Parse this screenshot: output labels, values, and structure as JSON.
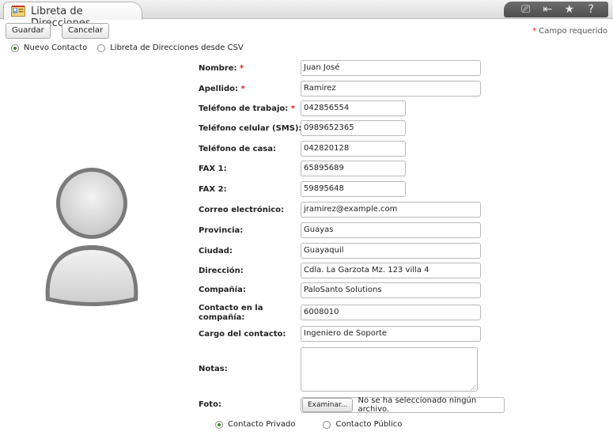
{
  "window": {
    "title": "Libreta de Direcciones",
    "toolbar_icons": [
      "edit-icon",
      "collapse-icon",
      "star-icon",
      "help-icon"
    ],
    "toolbar_glyphs": [
      "⎚",
      "⇤",
      "★",
      "?"
    ]
  },
  "actions": {
    "save_label": "Guardar",
    "cancel_label": "Cancelar",
    "required_note": "Campo requerido",
    "required_mark": "*"
  },
  "mode": {
    "options": [
      "Nuevo Contacto",
      "Libreta de Direcciones desde CSV"
    ],
    "selected": "Nuevo Contacto"
  },
  "form": {
    "nombre": {
      "label": "Nombre:",
      "value": "Juan José",
      "required": true
    },
    "apellido": {
      "label": "Apellido:",
      "value": "Ramirez",
      "required": true
    },
    "telefono_trabajo": {
      "label": "Teléfono de trabajo:",
      "value": "042856554",
      "required": true
    },
    "telefono_celular": {
      "label": "Teléfono celular (SMS):",
      "value": "0989652365"
    },
    "telefono_casa": {
      "label": "Teléfono de casa:",
      "value": "042820128"
    },
    "fax1": {
      "label": "FAX 1:",
      "value": "65895689"
    },
    "fax2": {
      "label": "FAX 2:",
      "value": "59895648"
    },
    "correo": {
      "label": "Correo electrónico:",
      "value": "jramirez@example.com"
    },
    "provincia": {
      "label": "Provincia:",
      "value": "Guayas"
    },
    "ciudad": {
      "label": "Ciudad:",
      "value": "Guayaquil"
    },
    "direccion": {
      "label": "Dirección:",
      "value": "Cdla. La Garzota Mz. 123 villa 4"
    },
    "compania": {
      "label": "Compañía:",
      "value": "PaloSanto Solutions"
    },
    "contacto_compania": {
      "label": "Contacto en la compañía:",
      "value": "6008010"
    },
    "cargo": {
      "label": "Cargo del contacto:",
      "value": "Ingeniero de Soporte"
    },
    "notas": {
      "label": "Notas:",
      "value": ""
    },
    "foto": {
      "label": "Foto:",
      "button": "Examinar...",
      "status": "No se ha seleccionado ningún archivo."
    }
  },
  "visibility": {
    "options": [
      "Contacto Privado",
      "Contacto Público"
    ],
    "selected": "Contacto Privado"
  },
  "colors": {
    "required": "#e41b17",
    "radio_selected": "#3d8b1f",
    "toolbar_bg": "#5a5a5a"
  }
}
